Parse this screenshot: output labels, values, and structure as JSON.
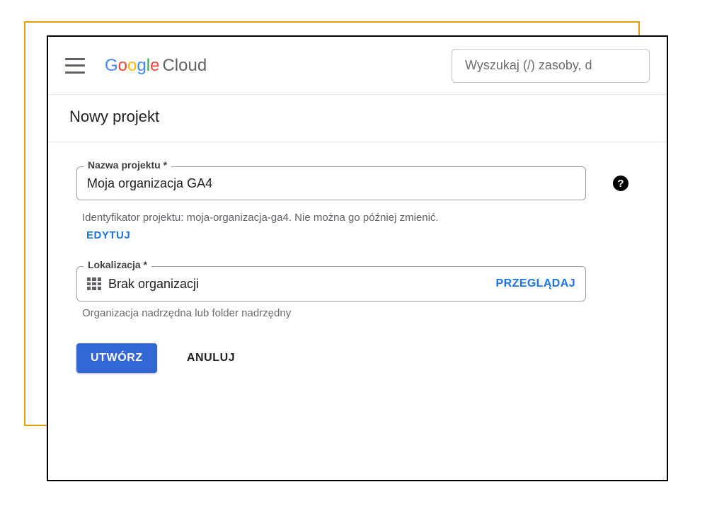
{
  "header": {
    "logo_cloud": "Cloud",
    "search_placeholder": "Wyszukaj (/) zasoby, d"
  },
  "page_title": "Nowy projekt",
  "form": {
    "project_name": {
      "label": "Nazwa projektu *",
      "value": "Moja organizacja GA4"
    },
    "project_id_helper_prefix": "Identyfikator projektu: ",
    "project_id_value": "moja-organizacja-ga4",
    "project_id_helper_suffix": ". Nie można go później zmienić.",
    "edit_label": "EDYTUJ",
    "location": {
      "label": "Lokalizacja *",
      "value": "Brak organizacji",
      "browse_label": "PRZEGLĄDAJ",
      "helper": "Organizacja nadrzędna lub folder nadrzędny"
    }
  },
  "buttons": {
    "create": "UTWÓRZ",
    "cancel": "ANULUJ"
  }
}
